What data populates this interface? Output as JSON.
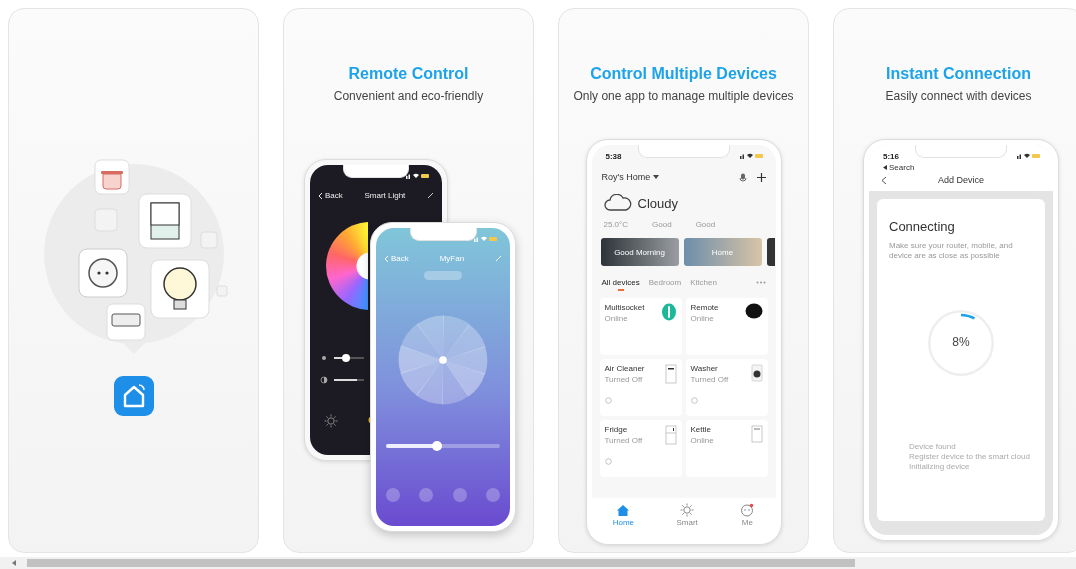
{
  "cards": [
    {
      "kind": "logo"
    },
    {
      "kind": "remote",
      "title": "Remote Control",
      "subtitle": "Convenient and eco-friendly",
      "light_phone": {
        "back": "Back",
        "title": "Smart Light",
        "sliders": [
          {
            "level": 0.4
          },
          {
            "level": 0.75
          }
        ]
      },
      "fan_phone": {
        "back": "Back",
        "title": "MyFan",
        "slider": {
          "level": 0.45
        }
      }
    },
    {
      "kind": "devices",
      "title": "Control Multiple Devices",
      "subtitle": "Only one app to manage multiple devices",
      "phone": {
        "time": "5:38",
        "home": "Roy's Home",
        "weather": "Cloudy",
        "stats": [
          "25.0°C",
          "Good",
          "Good"
        ],
        "scenes": [
          {
            "label": "Good Morning"
          },
          {
            "label": "Home"
          }
        ],
        "tabs": [
          {
            "label": "All devices",
            "selected": true
          },
          {
            "label": "Bedroom",
            "selected": false
          },
          {
            "label": "Kitchen",
            "selected": false
          }
        ],
        "devices": [
          {
            "name": "Multisocket",
            "status": "Online",
            "kind": "socket",
            "power_button": false
          },
          {
            "name": "Remote",
            "status": "Online",
            "kind": "remote",
            "power_button": false
          },
          {
            "name": "Air Cleaner",
            "status": "Turned Off",
            "kind": "purifier",
            "power_button": true
          },
          {
            "name": "Washer",
            "status": "Turned Off",
            "kind": "washer",
            "power_button": true
          },
          {
            "name": "Fridge",
            "status": "Turned Off",
            "kind": "fridge",
            "power_button": true
          },
          {
            "name": "Kettle",
            "status": "Online",
            "kind": "kettle",
            "power_button": false
          }
        ],
        "nav": [
          {
            "label": "Home",
            "selected": true
          },
          {
            "label": "Smart",
            "selected": false
          },
          {
            "label": "Me",
            "selected": false
          }
        ]
      }
    },
    {
      "kind": "connect",
      "title": "Instant Connection",
      "subtitle": "Easily connect with devices",
      "phone": {
        "time": "5:16",
        "back_link": "Search",
        "title": "Add Device",
        "heading": "Connecting",
        "hint": "Make sure your router, mobile, and device are as close as possible",
        "progress": {
          "level": 0.08,
          "reading": "8%"
        },
        "log": [
          "Device found",
          "Register device to the smart cloud",
          "Initializing device"
        ]
      }
    }
  ]
}
